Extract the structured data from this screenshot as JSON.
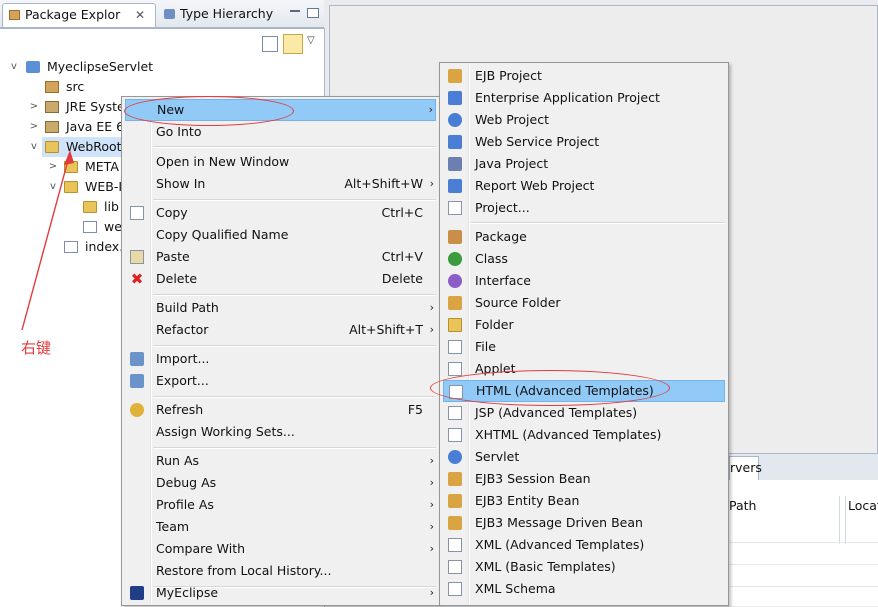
{
  "explorer": {
    "tabs": [
      {
        "label": "Package Explor",
        "close": "✕"
      },
      {
        "label": "Type Hierarchy"
      }
    ],
    "tree": [
      {
        "label": "MyeclipseServlet"
      },
      {
        "label": "src"
      },
      {
        "label": "JRE Syste"
      },
      {
        "label": "Java EE 6"
      },
      {
        "label": "WebRoot"
      },
      {
        "label": "META"
      },
      {
        "label": "WEB-I"
      },
      {
        "label": "lib"
      },
      {
        "label": "we"
      },
      {
        "label": "index."
      }
    ]
  },
  "servers": {
    "tab_label": "rvers",
    "columns": [
      "Path",
      "Locat"
    ]
  },
  "context_menu": {
    "items": [
      {
        "label": "New",
        "shortcut": "",
        "submenu": true
      },
      {
        "label": "Go Into",
        "shortcut": ""
      },
      {
        "label": "Open in New Window",
        "shortcut": ""
      },
      {
        "label": "Show In",
        "shortcut": "Alt+Shift+W",
        "submenu": true
      },
      {
        "label": "Copy",
        "shortcut": "Ctrl+C"
      },
      {
        "label": "Copy Qualified Name",
        "shortcut": ""
      },
      {
        "label": "Paste",
        "shortcut": "Ctrl+V"
      },
      {
        "label": "Delete",
        "shortcut": "Delete"
      },
      {
        "label": "Build Path",
        "shortcut": "",
        "submenu": true
      },
      {
        "label": "Refactor",
        "shortcut": "Alt+Shift+T",
        "submenu": true
      },
      {
        "label": "Import...",
        "shortcut": ""
      },
      {
        "label": "Export...",
        "shortcut": ""
      },
      {
        "label": "Refresh",
        "shortcut": "F5"
      },
      {
        "label": "Assign Working Sets...",
        "shortcut": ""
      },
      {
        "label": "Run As",
        "shortcut": "",
        "submenu": true
      },
      {
        "label": "Debug As",
        "shortcut": "",
        "submenu": true
      },
      {
        "label": "Profile As",
        "shortcut": "",
        "submenu": true
      },
      {
        "label": "Team",
        "shortcut": "",
        "submenu": true
      },
      {
        "label": "Compare With",
        "shortcut": "",
        "submenu": true
      },
      {
        "label": "Restore from Local History...",
        "shortcut": ""
      },
      {
        "label": "MyEclipse",
        "shortcut": "",
        "submenu": true
      }
    ],
    "arrow": "›"
  },
  "new_submenu": {
    "items": [
      {
        "label": "EJB Project",
        "icon": "ejb-project-icon"
      },
      {
        "label": "Enterprise Application Project",
        "icon": "ear-project-icon"
      },
      {
        "label": "Web Project",
        "icon": "web-project-icon"
      },
      {
        "label": "Web Service Project",
        "icon": "web-service-project-icon"
      },
      {
        "label": "Java Project",
        "icon": "java-project-icon"
      },
      {
        "label": "Report Web Project",
        "icon": "report-project-icon"
      },
      {
        "label": "Project...",
        "icon": "project-icon"
      },
      {
        "label": "Package",
        "icon": "package-icon"
      },
      {
        "label": "Class",
        "icon": "class-icon"
      },
      {
        "label": "Interface",
        "icon": "interface-icon"
      },
      {
        "label": "Source Folder",
        "icon": "source-folder-icon"
      },
      {
        "label": "Folder",
        "icon": "folder-icon"
      },
      {
        "label": "File",
        "icon": "file-icon"
      },
      {
        "label": "Applet",
        "icon": "applet-icon"
      },
      {
        "label": "HTML (Advanced Templates)",
        "icon": "html-file-icon"
      },
      {
        "label": "JSP (Advanced Templates)",
        "icon": "jsp-file-icon"
      },
      {
        "label": "XHTML (Advanced Templates)",
        "icon": "xhtml-file-icon"
      },
      {
        "label": "Servlet",
        "icon": "servlet-icon"
      },
      {
        "label": "EJB3 Session Bean",
        "icon": "session-bean-icon"
      },
      {
        "label": "EJB3 Entity Bean",
        "icon": "entity-bean-icon"
      },
      {
        "label": "EJB3 Message Driven Bean",
        "icon": "mdb-icon"
      },
      {
        "label": "XML (Advanced Templates)",
        "icon": "xml-file-icon"
      },
      {
        "label": "XML (Basic Templates)",
        "icon": "xml-basic-icon"
      },
      {
        "label": "XML Schema",
        "icon": "xml-schema-icon"
      }
    ]
  },
  "annotation": {
    "text": "右键",
    "color": "#e23b3b"
  },
  "colors": {
    "menu_highlight": "#91c9f7",
    "tree_selection": "#cfe4fb"
  }
}
